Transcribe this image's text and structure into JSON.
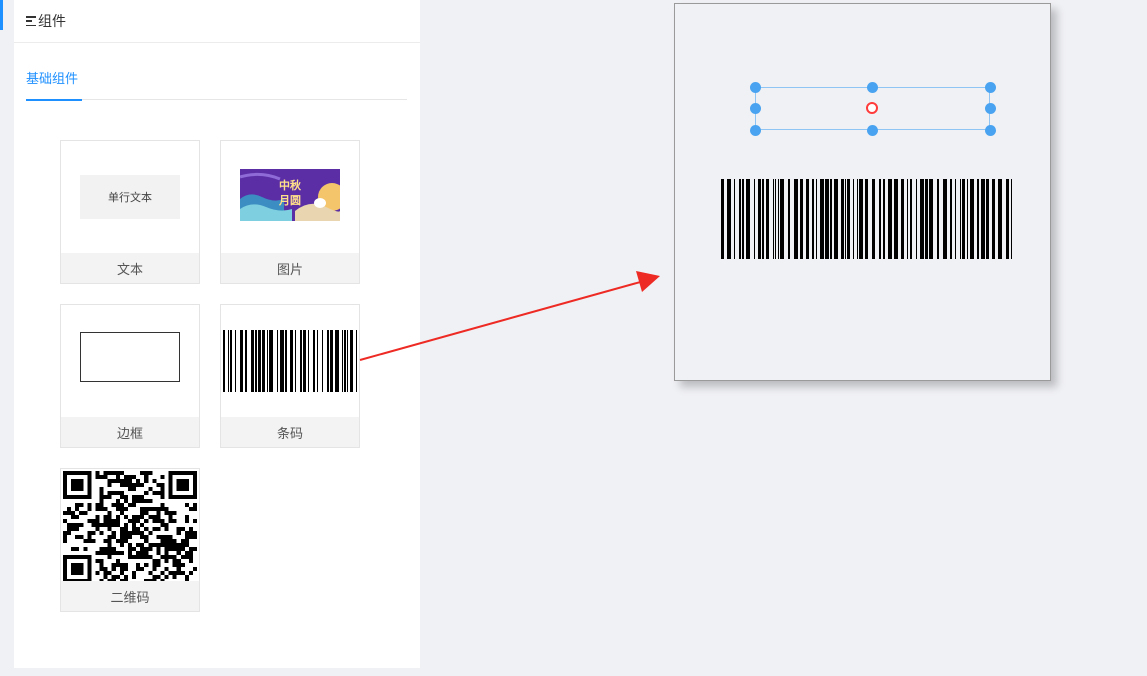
{
  "panel": {
    "title": "组件",
    "tabs": [
      {
        "label": "基础组件",
        "active": true
      }
    ]
  },
  "components": [
    {
      "label": "文本",
      "preview_text": "单行文本",
      "icon": "text-preview"
    },
    {
      "label": "图片",
      "preview_text": "中秋月圆",
      "icon": "mid-autumn-image"
    },
    {
      "label": "边框",
      "icon": "border-rectangle"
    },
    {
      "label": "条码",
      "icon": "barcode-preview"
    },
    {
      "label": "二维码",
      "icon": "qrcode-preview"
    }
  ],
  "canvas": {
    "selected_element": "text",
    "placed_element": "barcode"
  },
  "colors": {
    "accent": "#1e90ff",
    "handle": "#4aa3f0",
    "rotate": "#ff3b3b",
    "arrow": "#ee2a24",
    "image_bg": "#5b2ea6"
  }
}
